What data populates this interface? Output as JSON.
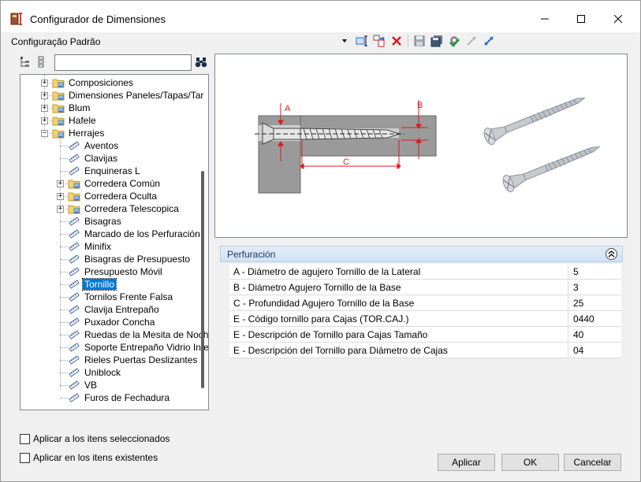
{
  "window": {
    "title": "Configurador de Dimensiones"
  },
  "config": {
    "label": "Configuração Padrão"
  },
  "search": {
    "value": "",
    "placeholder": ""
  },
  "tree": {
    "items": [
      {
        "label": "Composiciones",
        "type": "folder",
        "level": 0,
        "expander": "+"
      },
      {
        "label": "Dimensiones Paneles/Tapas/Tar",
        "type": "folder",
        "level": 0,
        "expander": "+"
      },
      {
        "label": "Blum",
        "type": "folder",
        "level": 0,
        "expander": "+"
      },
      {
        "label": "Hafele",
        "type": "folder",
        "level": 0,
        "expander": "+"
      },
      {
        "label": "Herrajes",
        "type": "folder",
        "level": 0,
        "expander": "−"
      },
      {
        "label": "Aventos",
        "type": "leaf",
        "level": 1
      },
      {
        "label": "Clavijas",
        "type": "leaf",
        "level": 1
      },
      {
        "label": "Enquineras L",
        "type": "leaf",
        "level": 1
      },
      {
        "label": "Corredera Común",
        "type": "folder",
        "level": 1,
        "expander": "+"
      },
      {
        "label": "Corredera Oculta",
        "type": "folder",
        "level": 1,
        "expander": "+"
      },
      {
        "label": "Corredera Telescopica",
        "type": "folder",
        "level": 1,
        "expander": "+"
      },
      {
        "label": "Bisagras",
        "type": "leaf",
        "level": 1
      },
      {
        "label": "Marcado de los Perfuración",
        "type": "leaf",
        "level": 1
      },
      {
        "label": "Minifix",
        "type": "leaf",
        "level": 1
      },
      {
        "label": "Bisagras de Presupuesto",
        "type": "leaf",
        "level": 1
      },
      {
        "label": "Presupuesto Móvil",
        "type": "leaf",
        "level": 1
      },
      {
        "label": "Tornillo",
        "type": "leaf",
        "level": 1,
        "selected": true
      },
      {
        "label": "Tornilos Frente Falsa",
        "type": "leaf",
        "level": 1
      },
      {
        "label": "Clavija Entrepaño",
        "type": "leaf",
        "level": 1
      },
      {
        "label": "Puxador Concha",
        "type": "leaf",
        "level": 1
      },
      {
        "label": "Ruedas de la Mesita de Noch",
        "type": "leaf",
        "level": 1
      },
      {
        "label": "Soporte Entrepaño Vidrio Inte",
        "type": "leaf",
        "level": 1
      },
      {
        "label": "Rieles Puertas Deslizantes",
        "type": "leaf",
        "level": 1
      },
      {
        "label": "Uniblock",
        "type": "leaf",
        "level": 1
      },
      {
        "label": "VB",
        "type": "leaf",
        "level": 1
      },
      {
        "label": "Furos de Fechadura",
        "type": "leaf",
        "level": 1
      }
    ]
  },
  "preview": {
    "label_a": "A",
    "label_b": "B",
    "label_c": "C"
  },
  "group": {
    "title": "Perfuración"
  },
  "properties": [
    {
      "name": "A - Diámetro de agujero Tornillo de la Lateral",
      "value": "5"
    },
    {
      "name": "B - Diámetro Agujero Tornillo de la Base",
      "value": "3"
    },
    {
      "name": "C - Profundidad Agujero Tornillo de la Base",
      "value": "25"
    },
    {
      "name": "E - Código tornillo para Cajas (TOR.CAJ.)",
      "value": "0440"
    },
    {
      "name": "E - Descripción de Tornillo para Cajas Tamaño",
      "value": "40"
    },
    {
      "name": "E - Descripción del Tornillo para Diámetro de Cajas",
      "value": "04"
    }
  ],
  "options": {
    "apply_selected": "Aplicar a los itens seleccionados",
    "apply_existing": "Aplicar en los itens existentes"
  },
  "buttons": {
    "apply": "Aplicar",
    "ok": "OK",
    "cancel": "Cancelar"
  },
  "colors": {
    "selection": "#0078d7",
    "accent_red": "#e0191f",
    "accent_blue": "#1e6fd9"
  }
}
